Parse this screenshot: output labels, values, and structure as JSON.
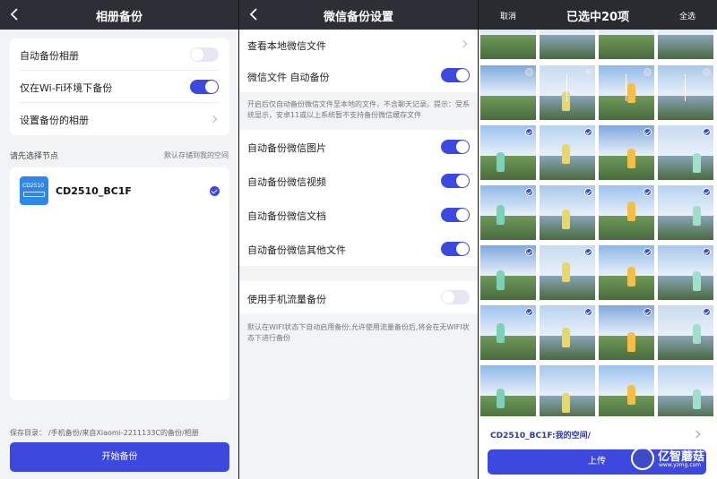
{
  "panel1": {
    "title": "相册备份",
    "rows": [
      {
        "label": "自动备份相册",
        "toggle": "off"
      },
      {
        "label": "仅在Wi-Fi环境下备份",
        "toggle": "on"
      },
      {
        "label": "设置备份的相册"
      }
    ],
    "node_hint": "请先选择节点",
    "node_default": "默认存储到我的空间",
    "device_icon_text": "CD2510",
    "device_name": "CD2510_BC1F",
    "save_label": "保存目录：",
    "save_path": "/手机备份/来自Xiaomi-2211133C的备份/相册",
    "start_button": "开始备份"
  },
  "panel2": {
    "title": "微信备份设置",
    "view_local": "查看本地微信文件",
    "wechat_auto": "微信文件 自动备份",
    "description1": "开启后仅自动备份微信文件至本地的文件，不含聊天记录。提示：受系统显示，安卓11或以上系统暂不支持备份微信缓存文件",
    "items": [
      {
        "label": "自动备份微信图片"
      },
      {
        "label": "自动备份微信视频"
      },
      {
        "label": "自动备份微信文档"
      },
      {
        "label": "自动备份微信其他文件"
      }
    ],
    "mobile_data": "使用手机流量备份",
    "description2": "默认在WIFI状态下自动启用备份;允许使用流量备份后,将会在无WIFI状态下进行备份"
  },
  "panel3": {
    "cancel": "取消",
    "title": "已选中20项",
    "select_all": "全选",
    "destination": "CD2510_BC1F:我的空间/",
    "upload_button": "上传",
    "watermark_name": "亿智蘑菇",
    "watermark_url": "www.yzmg.com"
  },
  "colors": {
    "accent": "#3d48df",
    "header": "#2e2f36"
  }
}
